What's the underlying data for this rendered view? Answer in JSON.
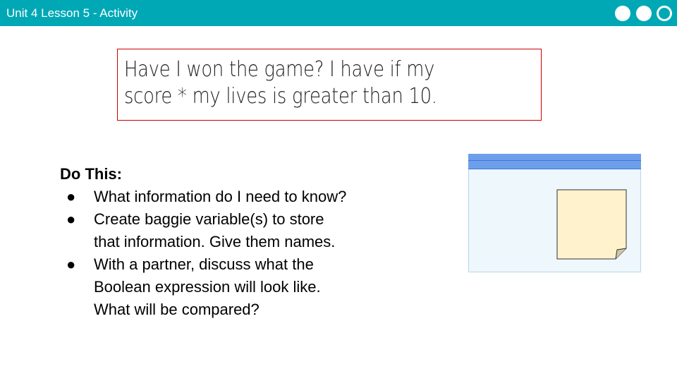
{
  "header": {
    "title": "Unit 4 Lesson 5 - Activity",
    "progress_dots": [
      "filled-dot-icon",
      "filled-dot-icon",
      "outline-dot-icon"
    ],
    "color": "#00a8b5"
  },
  "prompt": {
    "text": "Have I won the game? I have if my\nscore * my lives is greater than 10.",
    "border_color": "#cc0000"
  },
  "instructions": {
    "heading": "Do This:",
    "bullet_symbol": "●",
    "items": [
      "What information do I need to know?",
      "Create baggie variable(s) to store\nthat information. Give them names.",
      "With a partner, discuss what the\nBoolean expression will look like.\nWhat will be compared?"
    ]
  },
  "illustration": {
    "window_icon": "app-window-icon",
    "sticky_note_icon": "sticky-note-icon",
    "titlebar_color": "#6d9eeb",
    "note_color": "#fff2cc"
  }
}
